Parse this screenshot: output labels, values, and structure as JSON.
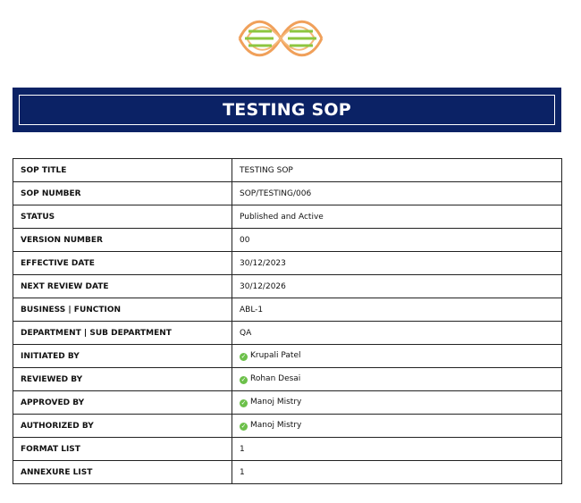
{
  "header": {
    "title": "TESTING SOP"
  },
  "colors": {
    "banner": "#0b2265",
    "logo_orange": "#f0a05a",
    "logo_green": "#8cc63f",
    "check_green": "#6cc04a"
  },
  "rows": [
    {
      "label": "SOP TITLE",
      "value": "TESTING SOP"
    },
    {
      "label": "SOP NUMBER",
      "value": "SOP/TESTING/006"
    },
    {
      "label": "STATUS",
      "value": "Published and Active"
    },
    {
      "label": "VERSION NUMBER",
      "value": "00"
    },
    {
      "label": "EFFECTIVE DATE",
      "value": "30/12/2023"
    },
    {
      "label": "NEXT REVIEW DATE",
      "value": "30/12/2026"
    },
    {
      "label": "BUSINESS | FUNCTION",
      "value": "ABL-1"
    },
    {
      "label": "DEPARTMENT | SUB DEPARTMENT",
      "value": "QA"
    },
    {
      "label": "INITIATED BY",
      "value": "Krupali Patel",
      "icon": "check-circle-icon"
    },
    {
      "label": "REVIEWED BY",
      "value": "Rohan Desai",
      "icon": "check-circle-icon"
    },
    {
      "label": "APPROVED BY",
      "value": "Manoj Mistry",
      "icon": "check-circle-icon"
    },
    {
      "label": "AUTHORIZED BY",
      "value": "Manoj Mistry",
      "icon": "check-circle-icon"
    },
    {
      "label": "FORMAT LIST",
      "value": "1"
    },
    {
      "label": "ANNEXURE LIST",
      "value": "1"
    }
  ]
}
